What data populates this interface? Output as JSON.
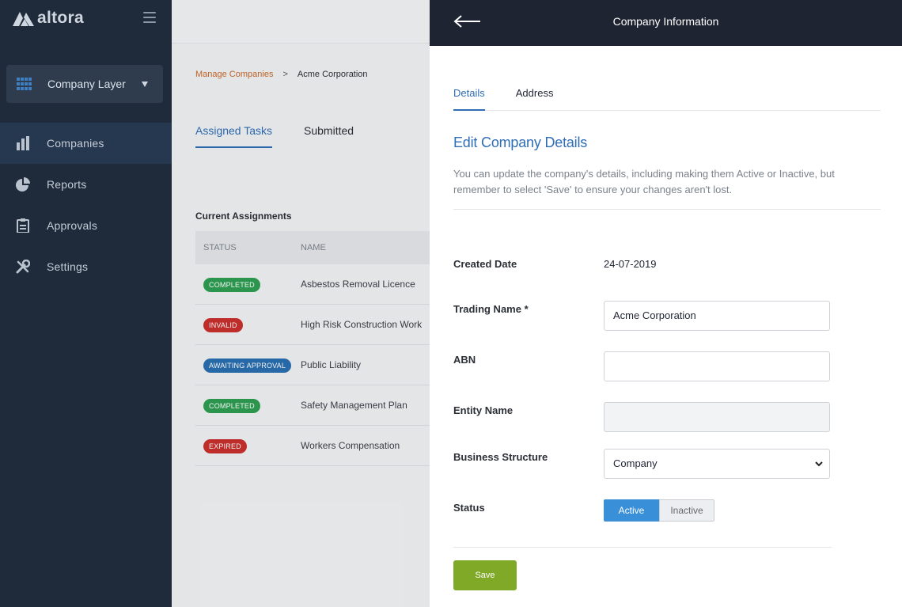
{
  "app": {
    "logo_text": "altora",
    "layer_label": "Company Layer"
  },
  "sidebar": {
    "items": [
      {
        "label": "Companies",
        "icon": "bar-chart-icon",
        "active": true
      },
      {
        "label": "Reports",
        "icon": "pie-chart-icon",
        "active": false
      },
      {
        "label": "Approvals",
        "icon": "clipboard-icon",
        "active": false
      },
      {
        "label": "Settings",
        "icon": "tools-icon",
        "active": false
      }
    ]
  },
  "main": {
    "breadcrumb": {
      "parent": "Manage Companies",
      "separator": ">",
      "current": "Acme Corporation"
    },
    "tabs": [
      {
        "label": "Assigned Tasks",
        "active": true
      },
      {
        "label": "Submitted",
        "active": false
      }
    ],
    "section_title": "Current Assignments",
    "table": {
      "headers": {
        "status": "STATUS",
        "name": "NAME"
      },
      "rows": [
        {
          "status": "COMPLETED",
          "status_color": "#2e9e52",
          "name": "Asbestos Removal Licence"
        },
        {
          "status": "INVALID",
          "status_color": "#c9302c",
          "name": "High Risk Construction Work"
        },
        {
          "status": "AWAITING APPROVAL",
          "status_color": "#2a6fb0",
          "name": "Public Liability"
        },
        {
          "status": "COMPLETED",
          "status_color": "#2e9e52",
          "name": "Safety Management Plan"
        },
        {
          "status": "EXPIRED",
          "status_color": "#c9302c",
          "name": "Workers Compensation"
        }
      ]
    }
  },
  "panel": {
    "title": "Company Information",
    "tabs": [
      {
        "label": "Details",
        "active": true
      },
      {
        "label": "Address",
        "active": false
      }
    ],
    "heading": "Edit Company Details",
    "description": "You can update the company's details, including making them Active or Inactive, but remember to select 'Save' to ensure your changes aren't lost.",
    "form": {
      "created_date_label": "Created Date",
      "created_date_value": "24-07-2019",
      "trading_name_label": "Trading Name *",
      "trading_name_value": "Acme Corporation",
      "abn_label": "ABN",
      "abn_value": "",
      "entity_name_label": "Entity Name",
      "entity_name_value": "",
      "business_structure_label": "Business Structure",
      "business_structure_value": "Company",
      "status_label": "Status",
      "status_active": "Active",
      "status_inactive": "Inactive",
      "status_selected": "Active"
    },
    "save_label": "Save"
  },
  "colors": {
    "sidebar_bg": "#1f2b3b",
    "accent_blue": "#2f6db5",
    "save_green": "#7fa927",
    "header_dark": "#1f2433"
  }
}
